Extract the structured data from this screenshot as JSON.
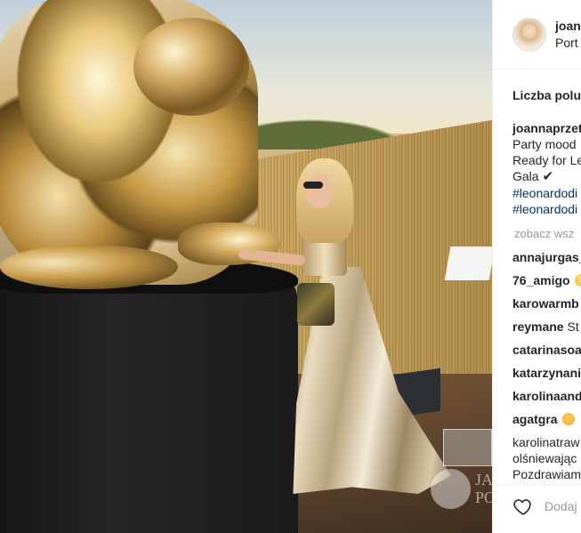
{
  "post": {
    "username": "joann",
    "location": "Port",
    "likes_label": "Liczba polul",
    "caption": {
      "author": "joannaprzet",
      "line1": "Party mood",
      "line2": "Ready for Le",
      "line3": "Gala",
      "check": "✔",
      "tag1": "#leonardodi",
      "tag2": "#leonardodi"
    },
    "see_all": "zobacz wsz",
    "comments": [
      {
        "user": "annajurgas_",
        "text": ""
      },
      {
        "user": "76_amigo",
        "text": ""
      },
      {
        "user": "karowarmb",
        "text": ""
      },
      {
        "user": "reymane",
        "text": "St"
      },
      {
        "user": "catarinasoa",
        "text": ""
      },
      {
        "user": "katarzynani",
        "text": ""
      },
      {
        "user": "karolinaand",
        "text": ""
      },
      {
        "user": "agatgra",
        "text": ""
      }
    ],
    "last_comment": {
      "user": "karolinatraw",
      "line2": "olśniewając",
      "line3": "Pozdrawiam"
    },
    "add_comment_placeholder": "Dodaj",
    "watermark": "JA PO"
  },
  "icons": {
    "like": "heart-outline-icon",
    "check": "check-mark-icon",
    "emoji_smile": "smiling-face-emoji-icon",
    "emoji_heart_eyes": "heart-eyes-emoji-icon"
  },
  "colors": {
    "hashtag": "#003569",
    "muted": "#999999",
    "text": "#262626",
    "border": "#efefef"
  }
}
